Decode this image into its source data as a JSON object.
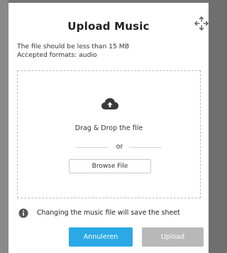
{
  "dialog": {
    "title": "Upload Music",
    "move_icon": "move-arrows-icon",
    "max_size_text": "The file should be less than 15 MB",
    "formats_text": "Accepted formats: audio"
  },
  "dropzone": {
    "icon": "cloud-upload-icon",
    "drop_text": "Drag & Drop the file",
    "or_text": "or",
    "browse_label": "Browse File"
  },
  "notice": {
    "icon": "info-icon",
    "text": "Changing the music file will save the sheet"
  },
  "footer": {
    "cancel_label": "Annuleren",
    "upload_label": "Upload",
    "upload_disabled": true
  },
  "colors": {
    "accent": "#2ba9e6",
    "disabled": "#b8b8b8"
  }
}
